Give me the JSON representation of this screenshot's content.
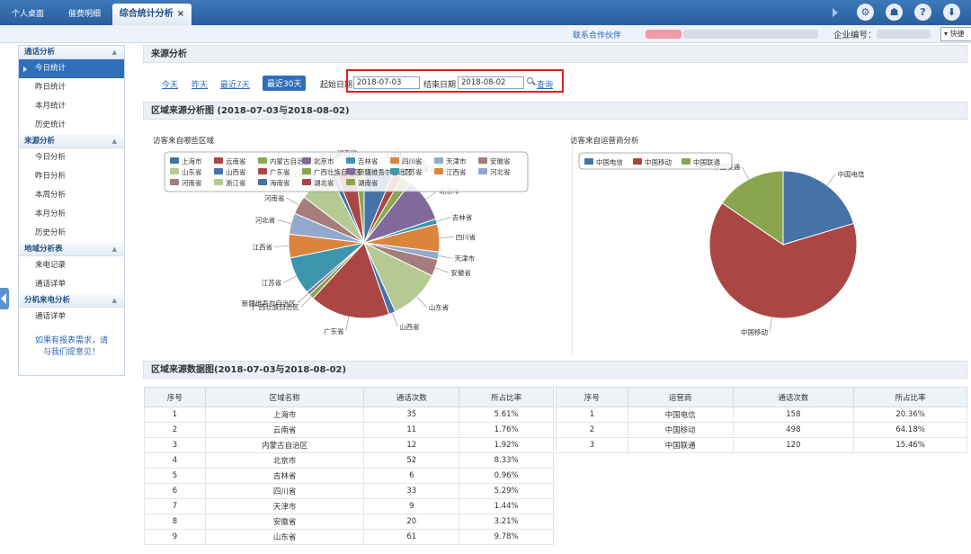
{
  "tabs": [
    {
      "label": "个人桌面"
    },
    {
      "label": "催费明细"
    },
    {
      "label": "综合统计分析",
      "close": "×"
    }
  ],
  "topbar": {
    "icons": [
      "settings-icon",
      "user-icon",
      "help-icon",
      "logout-icon"
    ],
    "icon_glyphs": [
      "⚙",
      "☗",
      "?",
      "⬇"
    ]
  },
  "subbar": {
    "partner_link": "联系合作伙伴",
    "company_label": "企业编号：",
    "dropdown_label": "▾ 快捷"
  },
  "sidebar": {
    "groups": [
      {
        "title": "通话分析",
        "items": [
          "今日统计",
          "昨日统计",
          "本月统计",
          "历史统计"
        ]
      },
      {
        "title": "来源分析",
        "items": [
          "今日分析",
          "昨日分析",
          "本周分析",
          "本月分析",
          "历史分析"
        ]
      },
      {
        "title": "地域分析表",
        "items": [
          "来电记录",
          "通话详单"
        ]
      },
      {
        "title": "分机来电分析",
        "items": [
          "通话详单"
        ]
      }
    ],
    "active_item": "今日统计",
    "help_text_1": "如果有报表需求，请",
    "help_text_2": "与我们提意见！"
  },
  "filter": {
    "title": "来源分析",
    "quick_ranges": [
      "今天",
      "昨天",
      "最近7天",
      "最近30天"
    ],
    "active_range": "最近30天",
    "start_label": "起始日期",
    "start_value": "2018-07-03",
    "end_label": "结束日期",
    "end_value": "2018-08-02",
    "search_label": "查询"
  },
  "chart_section_title": "区域来源分析图 (2018-07-03与2018-08-02)",
  "table_section_title": "区域来源数据图(2018-07-03与2018-08-02)",
  "colors": {
    "accent": "#2f6fba",
    "highlight_box": "#e02020"
  },
  "chart_data": [
    {
      "type": "pie",
      "title": "访客来自哪些区域",
      "legend_position": "top",
      "slices": [
        {
          "name": "上海市",
          "value": 35,
          "color": "#4572A7"
        },
        {
          "name": "云南省",
          "value": 11,
          "color": "#AA4643"
        },
        {
          "name": "内蒙古自治区",
          "value": 12,
          "color": "#89A54E"
        },
        {
          "name": "北京市",
          "value": 52,
          "color": "#80699B"
        },
        {
          "name": "吉林省",
          "value": 6,
          "color": "#3D96AE"
        },
        {
          "name": "四川省",
          "value": 33,
          "color": "#DB843D"
        },
        {
          "name": "天津市",
          "value": 9,
          "color": "#92A8CD"
        },
        {
          "name": "安徽省",
          "value": 20,
          "color": "#A47D7C"
        },
        {
          "name": "山东省",
          "value": 61,
          "color": "#B5CA92"
        },
        {
          "name": "山西省",
          "value": 8,
          "color": "#4572A7"
        },
        {
          "name": "广东省",
          "value": 95,
          "color": "#AA4643"
        },
        {
          "name": "广西壮族自治区",
          "value": 6,
          "color": "#89A54E"
        },
        {
          "name": "新疆维吾尔自治区",
          "value": 4,
          "color": "#80699B"
        },
        {
          "name": "江苏省",
          "value": 45,
          "color": "#3D96AE"
        },
        {
          "name": "江西省",
          "value": 28,
          "color": "#DB843D"
        },
        {
          "name": "河北省",
          "value": 25,
          "color": "#92A8CD"
        },
        {
          "name": "河南省",
          "value": 22,
          "color": "#A47D7C"
        },
        {
          "name": "浙江省",
          "value": 40,
          "color": "#B5CA92"
        },
        {
          "name": "海南省",
          "value": 7,
          "color": "#4572A7"
        },
        {
          "name": "湖北省",
          "value": 24,
          "color": "#AA4643"
        },
        {
          "name": "湖南省",
          "value": 10,
          "color": "#89A54E"
        }
      ]
    },
    {
      "type": "pie",
      "title": "访客来自运营商分析",
      "legend_position": "top",
      "slices": [
        {
          "name": "中国电信",
          "value": 158,
          "color": "#4572A7"
        },
        {
          "name": "中国移动",
          "value": 498,
          "color": "#AA4643"
        },
        {
          "name": "中国联通",
          "value": 120,
          "color": "#89A54E"
        }
      ]
    }
  ],
  "region_table": {
    "headers": [
      "序号",
      "区域名称",
      "通话次数",
      "所占比率"
    ],
    "rows": [
      [
        "1",
        "上海市",
        "35",
        "5.61%"
      ],
      [
        "2",
        "云南省",
        "11",
        "1.76%"
      ],
      [
        "3",
        "内蒙古自治区",
        "12",
        "1.92%"
      ],
      [
        "4",
        "北京市",
        "52",
        "8.33%"
      ],
      [
        "5",
        "吉林省",
        "6",
        "0.96%"
      ],
      [
        "6",
        "四川省",
        "33",
        "5.29%"
      ],
      [
        "7",
        "天津市",
        "9",
        "1.44%"
      ],
      [
        "8",
        "安徽省",
        "20",
        "3.21%"
      ],
      [
        "9",
        "山东省",
        "61",
        "9.78%"
      ]
    ]
  },
  "carrier_table": {
    "headers": [
      "序号",
      "运营商",
      "通话次数",
      "所占比率"
    ],
    "rows": [
      [
        "1",
        "中国电信",
        "158",
        "20.36%"
      ],
      [
        "2",
        "中国移动",
        "498",
        "64.18%"
      ],
      [
        "3",
        "中国联通",
        "120",
        "15.46%"
      ]
    ]
  }
}
